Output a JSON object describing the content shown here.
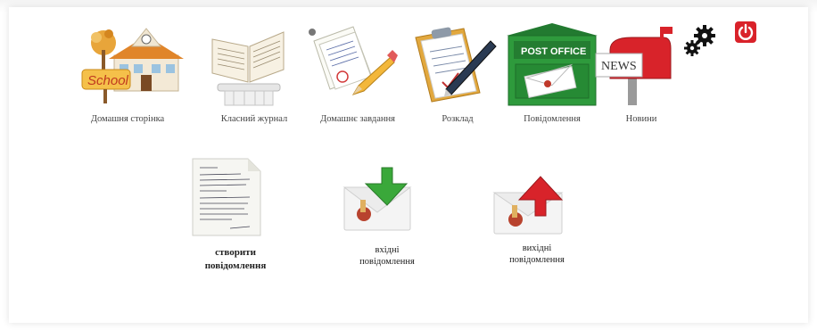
{
  "nav": {
    "items": [
      {
        "label": "Домашня сторінка",
        "icon": "school-house-icon"
      },
      {
        "label": "Класний журнал",
        "icon": "open-book-icon"
      },
      {
        "label": "Домашнє завдання",
        "icon": "homework-pencil-icon"
      },
      {
        "label": "Розклад",
        "icon": "clipboard-pen-icon"
      },
      {
        "label": "Повідомлення",
        "icon": "post-office-mailbox-icon"
      },
      {
        "label": "Новини",
        "icon": "news-mailbox-icon"
      }
    ],
    "school_sign_text": "School",
    "post_office_text": "POST OFFICE",
    "news_text": "NEWS"
  },
  "tools": {
    "settings_icon": "gears-icon",
    "logout_icon": "power-icon",
    "logout_color": "#d9222a"
  },
  "messages": {
    "create": {
      "line1": "створити",
      "line2": "повідомлення"
    },
    "inbox": {
      "line1": "вхідні",
      "line2": "повідомлення"
    },
    "outbox": {
      "line1": "вихідні",
      "line2": "повідомлення"
    }
  },
  "colors": {
    "inbox_arrow": "#3aa83a",
    "outbox_arrow": "#d8232a",
    "post_office_green": "#2e9a3c"
  }
}
